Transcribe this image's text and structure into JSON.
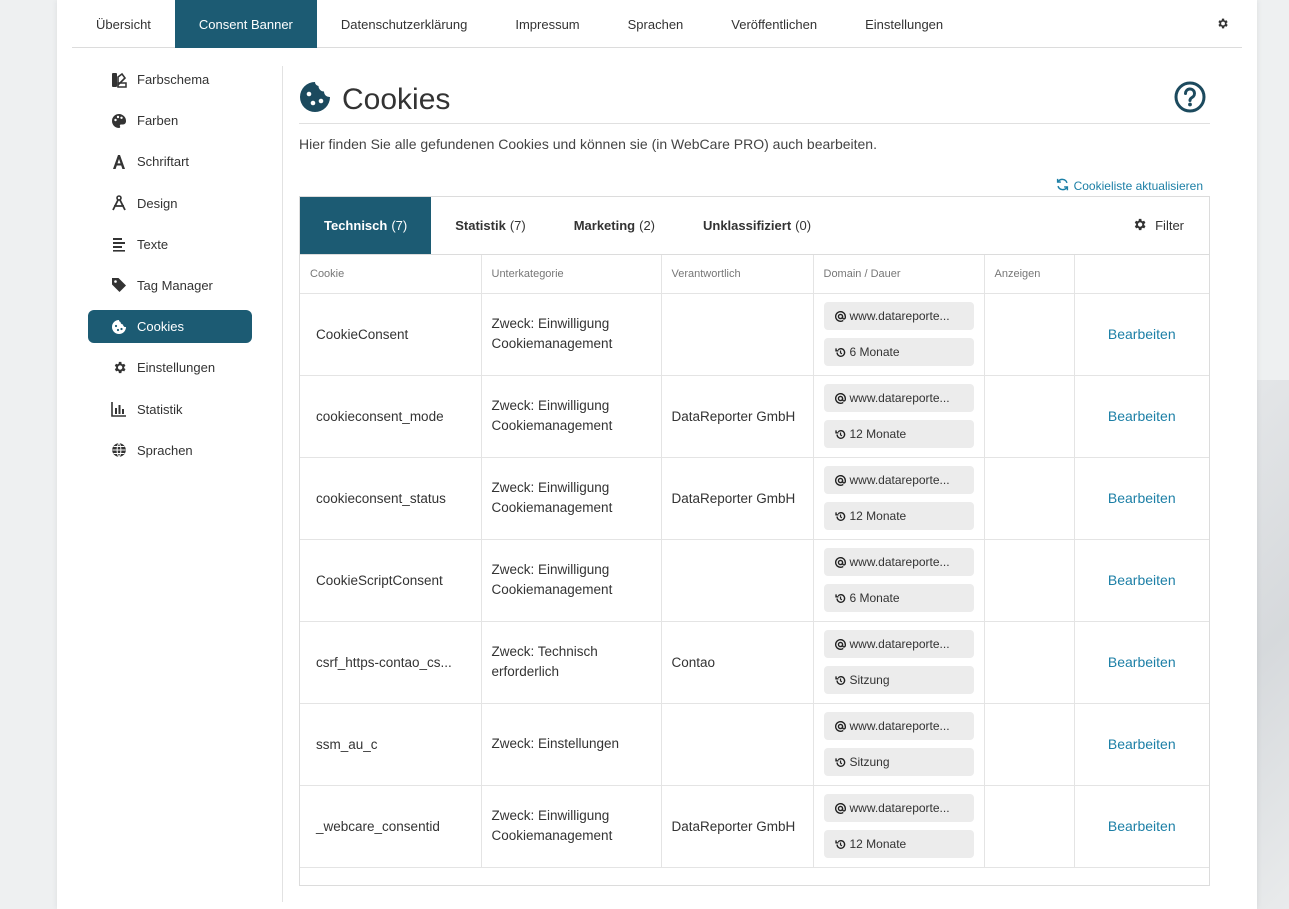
{
  "topnav": {
    "tabs": [
      {
        "label": "Übersicht",
        "active": false
      },
      {
        "label": "Consent Banner",
        "active": true
      },
      {
        "label": "Datenschutzerklärung",
        "active": false
      },
      {
        "label": "Impressum",
        "active": false
      },
      {
        "label": "Sprachen",
        "active": false
      },
      {
        "label": "Veröffentlichen",
        "active": false
      },
      {
        "label": "Einstellungen",
        "active": false
      }
    ],
    "settings_icon": "gear-icon"
  },
  "sidebar": {
    "items": [
      {
        "label": "Farbschema",
        "icon": "color-scheme-icon"
      },
      {
        "label": "Farben",
        "icon": "palette-icon"
      },
      {
        "label": "Schriftart",
        "icon": "font-icon"
      },
      {
        "label": "Design",
        "icon": "compass-drafting-icon"
      },
      {
        "label": "Texte",
        "icon": "text-align-icon"
      },
      {
        "label": "Tag Manager",
        "icon": "tag-icon"
      },
      {
        "label": "Cookies",
        "icon": "cookie-icon",
        "active": true
      },
      {
        "label": "Einstellungen",
        "icon": "gear-icon"
      },
      {
        "label": "Statistik",
        "icon": "bar-chart-icon"
      },
      {
        "label": "Sprachen",
        "icon": "globe-icon"
      }
    ]
  },
  "main": {
    "title": "Cookies",
    "description": "Hier finden Sie alle gefundenen Cookies und können sie (in WebCare PRO) auch bearbeiten.",
    "refresh_label": "Cookieliste aktualisieren",
    "filter_label": "Filter",
    "category_tabs": [
      {
        "name": "Technisch",
        "count": "(7)",
        "active": true
      },
      {
        "name": "Statistik",
        "count": "(7)"
      },
      {
        "name": "Marketing",
        "count": "(2)"
      },
      {
        "name": "Unklassifiziert",
        "count": "(0)"
      }
    ],
    "columns": [
      "Cookie",
      "Unterkategorie",
      "Verantwortlich",
      "Domain / Dauer",
      "Anzeigen",
      ""
    ],
    "rows": [
      {
        "cookie": "CookieConsent",
        "sub1": "Zweck: Einwilligung",
        "sub2": "Cookiemanagement",
        "responsible": "",
        "domain": "www.datareporte...",
        "duration": "6 Monate",
        "action": "Bearbeiten"
      },
      {
        "cookie": "cookieconsent_mode",
        "sub1": "Zweck: Einwilligung",
        "sub2": "Cookiemanagement",
        "responsible": "DataReporter GmbH",
        "domain": "www.datareporte...",
        "duration": "12 Monate",
        "action": "Bearbeiten"
      },
      {
        "cookie": "cookieconsent_status",
        "sub1": "Zweck: Einwilligung",
        "sub2": "Cookiemanagement",
        "responsible": "DataReporter GmbH",
        "domain": "www.datareporte...",
        "duration": "12 Monate",
        "action": "Bearbeiten"
      },
      {
        "cookie": "CookieScriptConsent",
        "sub1": "Zweck: Einwilligung",
        "sub2": "Cookiemanagement",
        "responsible": "",
        "domain": "www.datareporte...",
        "duration": "6 Monate",
        "action": "Bearbeiten"
      },
      {
        "cookie": "csrf_https-contao_cs...",
        "sub1": "Zweck: Technisch",
        "sub2": "erforderlich",
        "responsible": "Contao",
        "domain": "www.datareporte...",
        "duration": "Sitzung",
        "action": "Bearbeiten"
      },
      {
        "cookie": "ssm_au_c",
        "sub1": "Zweck: Einstellungen",
        "sub2": "",
        "responsible": "",
        "domain": "www.datareporte...",
        "duration": "Sitzung",
        "action": "Bearbeiten"
      },
      {
        "cookie": "_webcare_consentid",
        "sub1": "Zweck: Einwilligung",
        "sub2": "Cookiemanagement",
        "responsible": "DataReporter GmbH",
        "domain": "www.datareporte...",
        "duration": "12 Monate",
        "action": "Bearbeiten"
      }
    ]
  },
  "colors": {
    "accent": "#1c5b73",
    "link": "#1c7fa6"
  }
}
